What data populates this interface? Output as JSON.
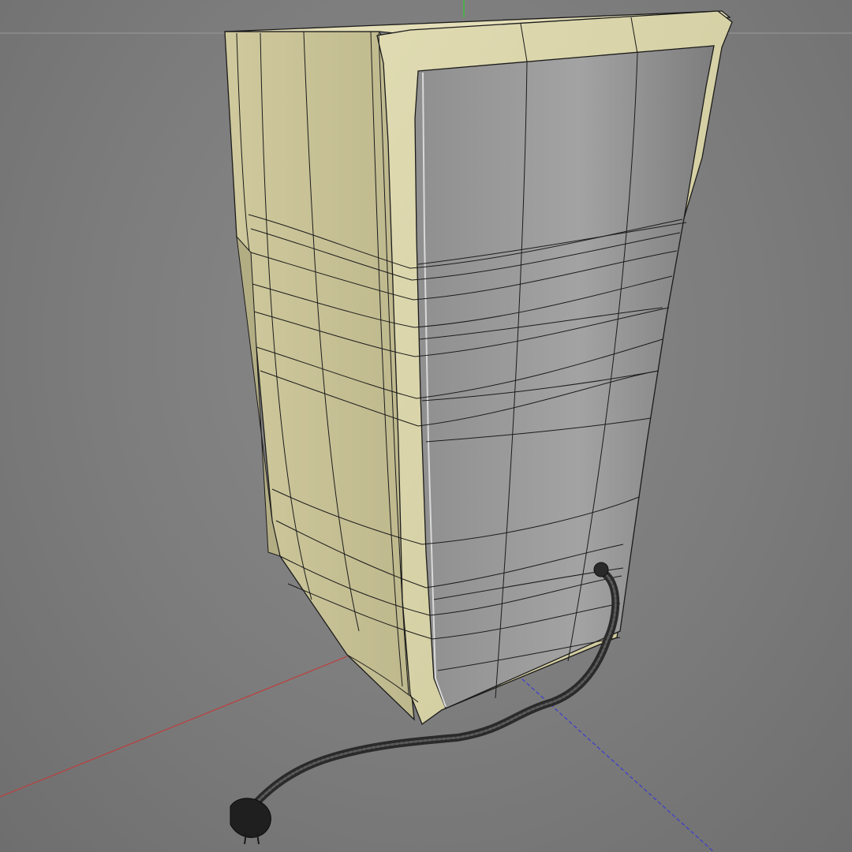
{
  "viewport": {
    "background_color": "#7f7f7f",
    "horizon_line_color": "#9a9a9a"
  },
  "axes": {
    "x_axis_color": "#c23b3b",
    "y_axis_color": "#3fbf3f",
    "z_axis_color": "#3b3bd0"
  },
  "model": {
    "body_color": "#d8d3a8",
    "body_shadow_color": "#bdb78d",
    "door_color": "#9a9a9a",
    "wire_color": "#1a1a1a",
    "cord_color": "#3a3a3a"
  },
  "icons": {
    "plug": "plug-icon"
  }
}
